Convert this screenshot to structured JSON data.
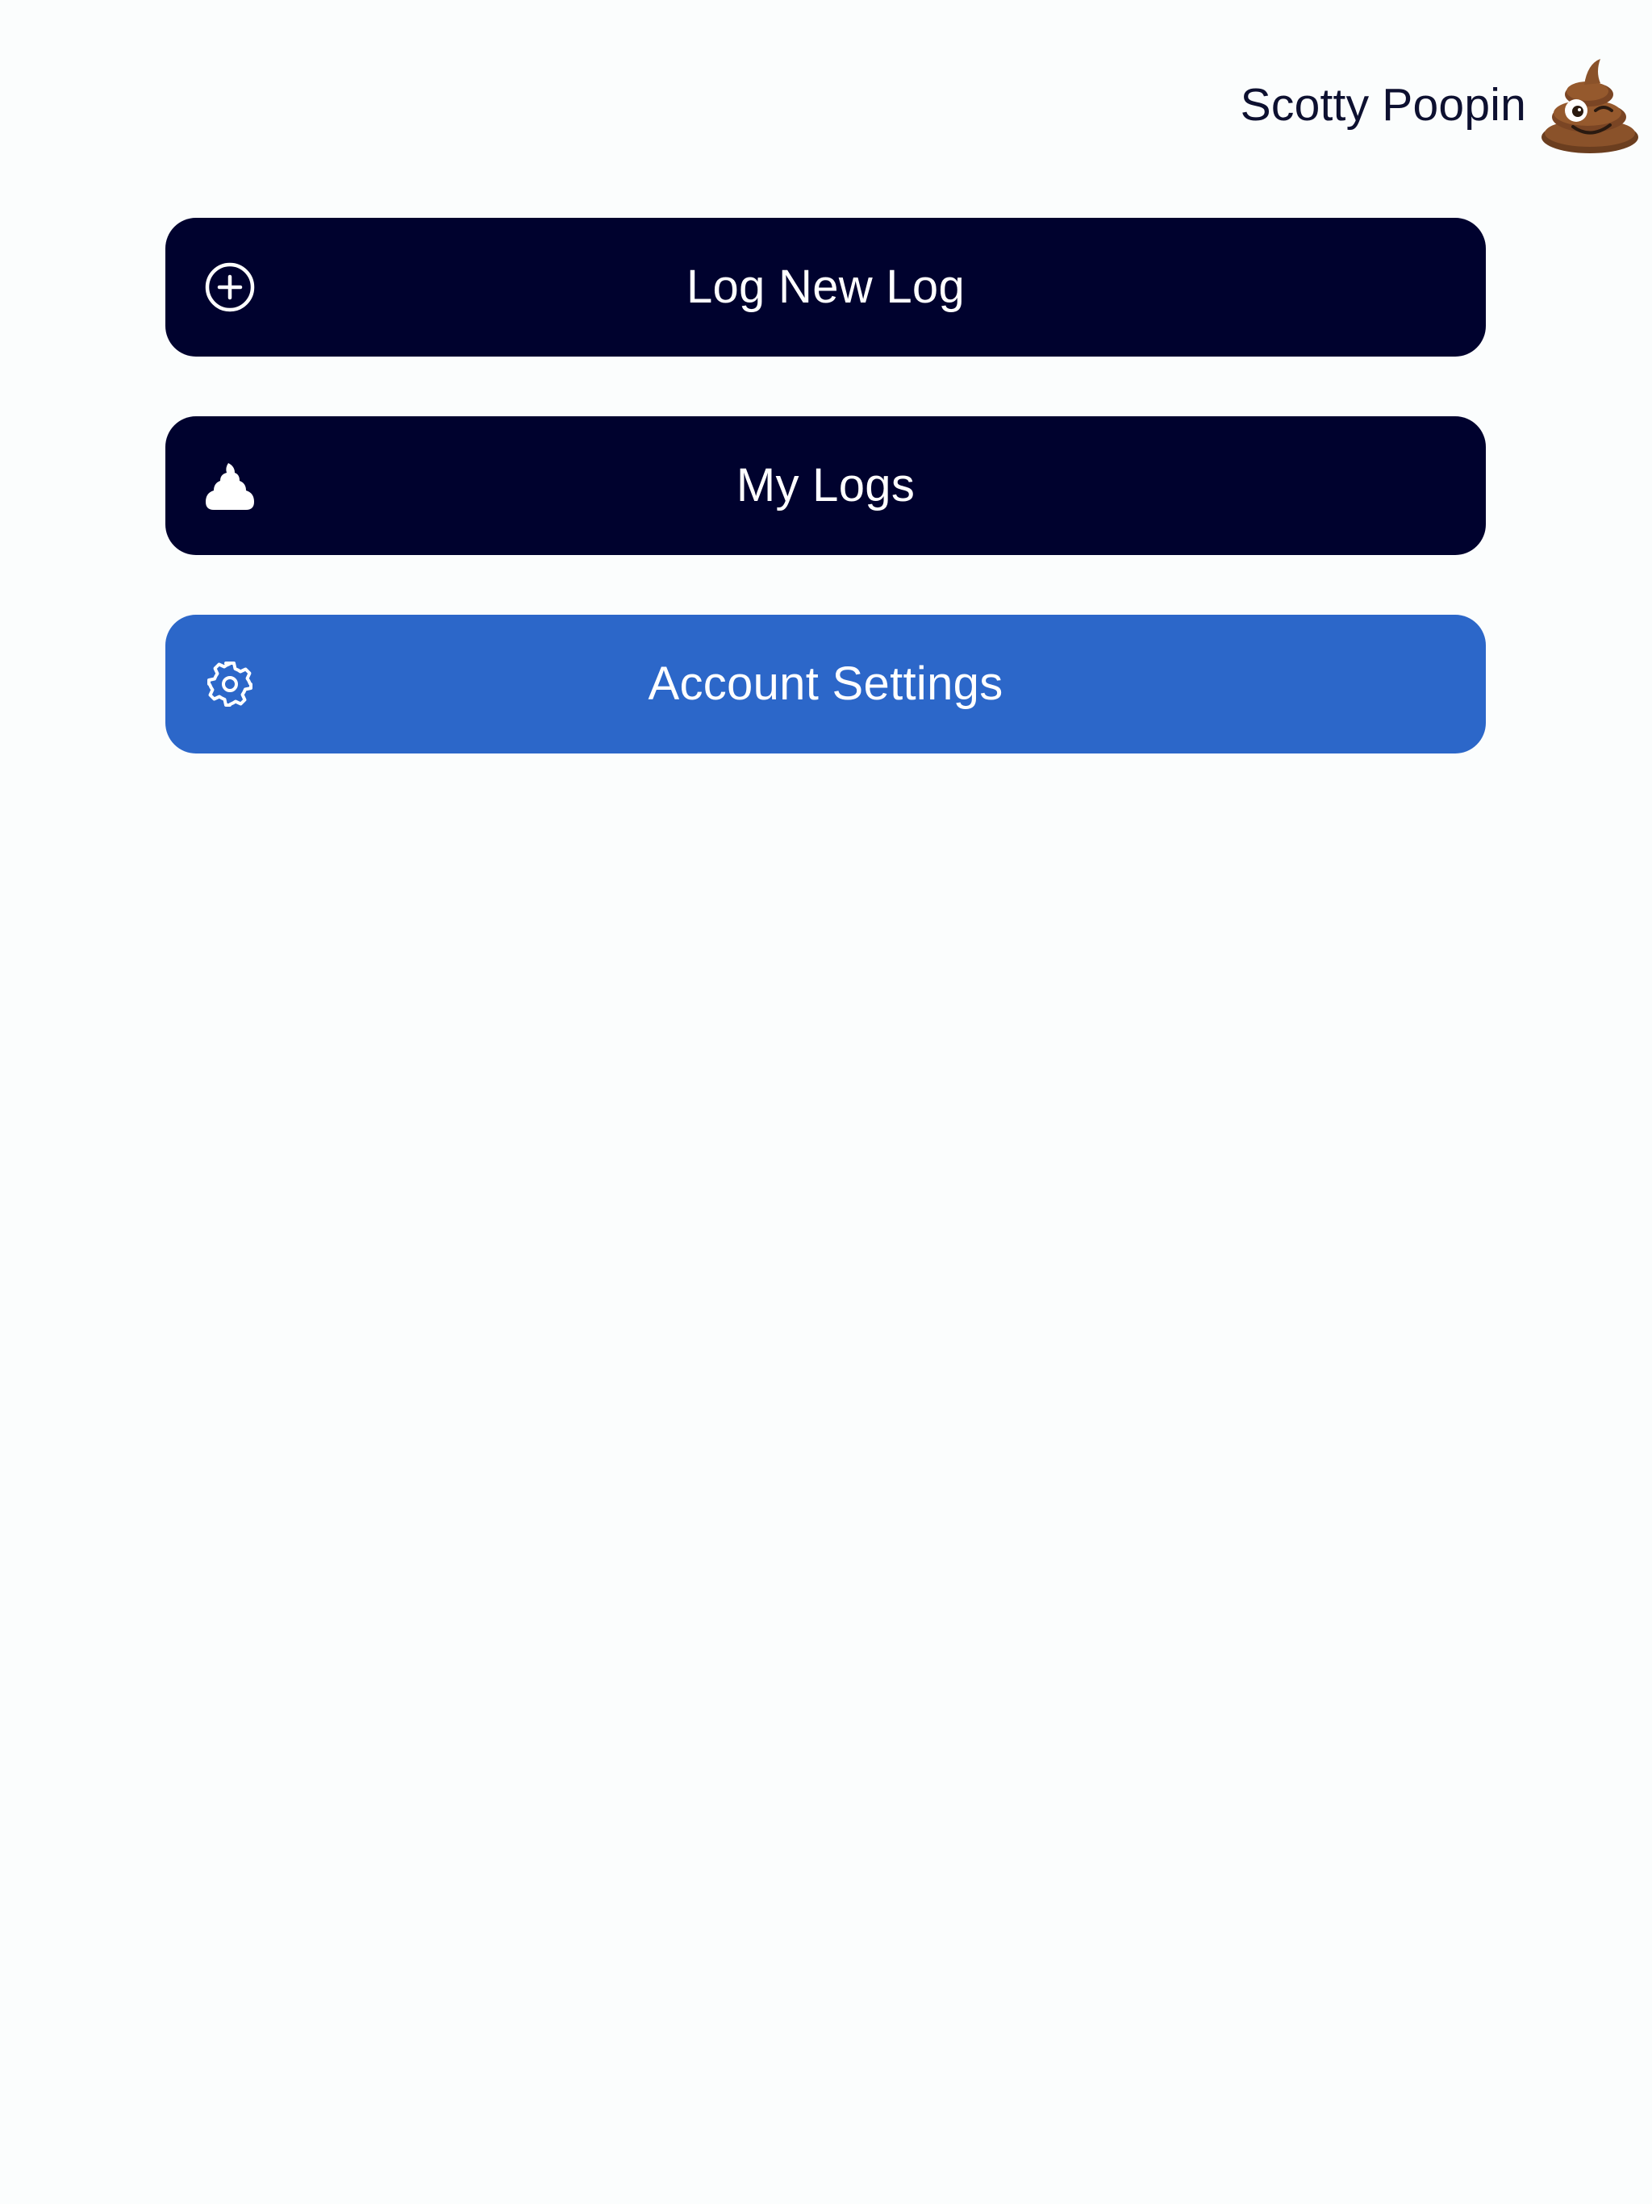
{
  "header": {
    "username": "Scotty Poopin",
    "avatar_icon": "smiling-poop-emoji-icon"
  },
  "menu": {
    "items": [
      {
        "label": "Log New Log",
        "icon": "plus-circle-icon",
        "color": "#00022e"
      },
      {
        "label": "My Logs",
        "icon": "poop-icon",
        "color": "#00022e"
      },
      {
        "label": "Account Settings",
        "icon": "gear-icon",
        "color": "#2c67c9"
      }
    ]
  },
  "colors": {
    "background": "#fbfdfd",
    "primary_dark": "#00022e",
    "accent_blue": "#2c67c9",
    "text_dark": "#0d1030"
  }
}
